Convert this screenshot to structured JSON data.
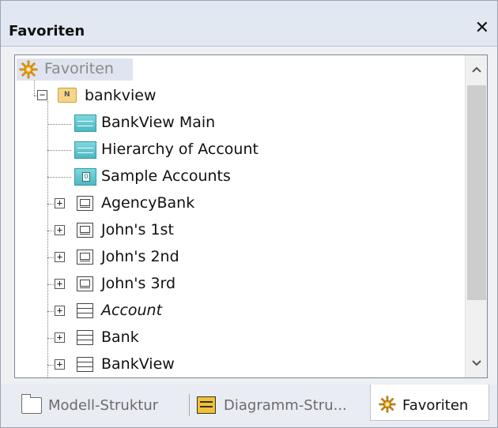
{
  "panel": {
    "title": "Favoriten",
    "close_glyph": "✕"
  },
  "tree": {
    "root": {
      "label": "Favoriten",
      "icon": "favorites-icon"
    },
    "package": {
      "label": "bankview",
      "icon": "package-folder-icon",
      "expander": "−"
    },
    "items": [
      {
        "label": "BankView Main",
        "icon": "class-diagram-icon",
        "italic": false
      },
      {
        "label": "Hierarchy of Account",
        "icon": "class-diagram-icon",
        "italic": false
      },
      {
        "label": "Sample Accounts",
        "icon": "object-diagram-icon",
        "italic": false
      },
      {
        "label": "AgencyBank",
        "icon": "instance-icon",
        "italic": false,
        "expander": "+"
      },
      {
        "label": "John's 1st",
        "icon": "instance-icon",
        "italic": false,
        "expander": "+"
      },
      {
        "label": "John's 2nd",
        "icon": "instance-icon",
        "italic": false,
        "expander": "+"
      },
      {
        "label": "John's 3rd",
        "icon": "instance-icon",
        "italic": false,
        "expander": "+"
      },
      {
        "label": "Account",
        "icon": "class-icon",
        "italic": true,
        "expander": "+"
      },
      {
        "label": "Bank",
        "icon": "class-icon",
        "italic": false,
        "expander": "+"
      },
      {
        "label": "BankView",
        "icon": "class-icon",
        "italic": false,
        "expander": "+"
      }
    ]
  },
  "tabs": [
    {
      "label": "Modell-Struktur",
      "icon": "folder-icon",
      "active": false
    },
    {
      "label": "Diagramm-Stru...",
      "icon": "diagram-structure-icon",
      "active": false
    },
    {
      "label": "Favoriten",
      "icon": "favorites-icon",
      "active": true
    }
  ],
  "colors": {
    "titlebar": "#e2e8f2",
    "selection": "#dfe4f0",
    "diagram_icon": "#4fb7c2",
    "favorites_star": "#f2a20c"
  }
}
